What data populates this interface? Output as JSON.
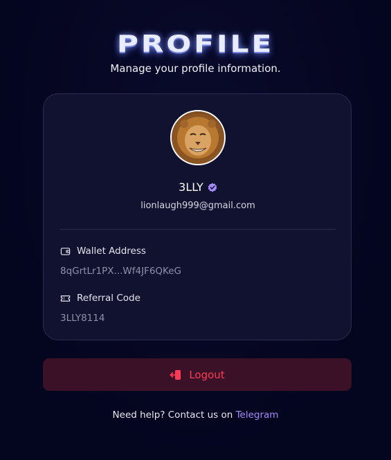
{
  "header": {
    "title": "PROFILE",
    "subtitle": "Manage your profile information."
  },
  "profile": {
    "username": "3LLY",
    "email": "lionlaugh999@gmail.com",
    "verified_icon": "verified-badge-icon",
    "avatar": "lion-avatar"
  },
  "fields": {
    "wallet": {
      "label": "Wallet Address",
      "value": "8qGrtLr1PX...Wf4JF6QKeG",
      "icon": "wallet-icon"
    },
    "referral": {
      "label": "Referral Code",
      "value": "3LLY8114",
      "icon": "ticket-icon"
    }
  },
  "actions": {
    "logout_label": "Logout",
    "logout_icon": "logout-icon"
  },
  "footer": {
    "help_text": "Need help? Contact us on",
    "link_text": "Telegram"
  },
  "colors": {
    "background": "#04051f",
    "card": "#101230",
    "accent": "#a78bfa",
    "danger": "#ff3b55",
    "danger_bg": "#3a1126"
  }
}
